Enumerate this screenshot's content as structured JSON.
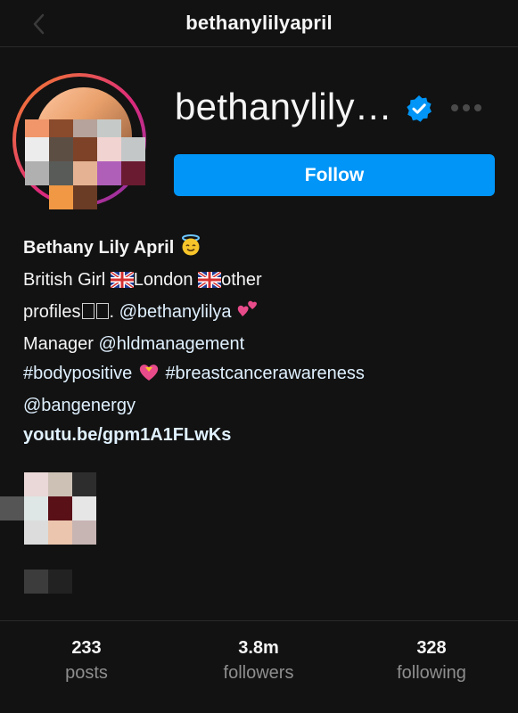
{
  "header": {
    "title": "bethanylilyapril"
  },
  "profile": {
    "username_display": "bethanylily…",
    "follow_label": "Follow",
    "accent_color": "#0095f6"
  },
  "bio": {
    "name": "Bethany Lily April",
    "line1_text": "British Girl ",
    "line1_mid": "London ",
    "line1_end": "other",
    "line2_text": "profiles",
    "line2_link": "@bethanylilya",
    "line3_text": "Manager ",
    "line3_link": "@hldmanagement",
    "line4_link1": "#bodypositive",
    "line4_link2": "#breastcancerawareness",
    "line5_link": "@bangenergy",
    "url": "youtu.be/gpm1A1FLwKs"
  },
  "stats": {
    "posts_count": "233",
    "posts_label": "posts",
    "followers_count": "3.8m",
    "followers_label": "followers",
    "following_count": "328",
    "following_label": "following"
  }
}
